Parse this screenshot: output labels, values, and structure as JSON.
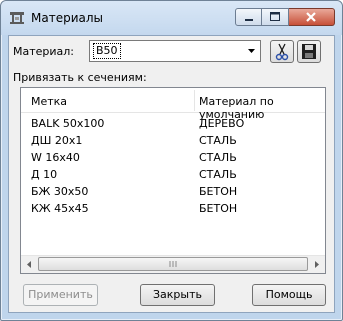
{
  "window": {
    "title": "Материалы"
  },
  "material": {
    "label": "Материал:",
    "value": "B50"
  },
  "bind_label": "Привязать к сечениям:",
  "table": {
    "columns": [
      "Метка",
      "Материал по умолчанию"
    ],
    "rows": [
      [
        "BALK 50x100",
        "ДЕРЕВО"
      ],
      [
        "ДШ 20x1",
        "СТАЛЬ"
      ],
      [
        "W 16x40",
        "СТАЛЬ"
      ],
      [
        "Д 10",
        "СТАЛЬ"
      ],
      [
        "БЖ 30x50",
        "БЕТОН"
      ],
      [
        "КЖ 45x45",
        "БЕТОН"
      ]
    ]
  },
  "buttons": {
    "apply": "Применить",
    "close": "Закрыть",
    "help": "Помощь"
  },
  "icons": {
    "title": "materials-icon",
    "cut": "scissors-icon",
    "save": "floppy-disk-icon"
  },
  "colors": {
    "close_button": "#c75038",
    "titlebar": "#c4d8ee"
  }
}
